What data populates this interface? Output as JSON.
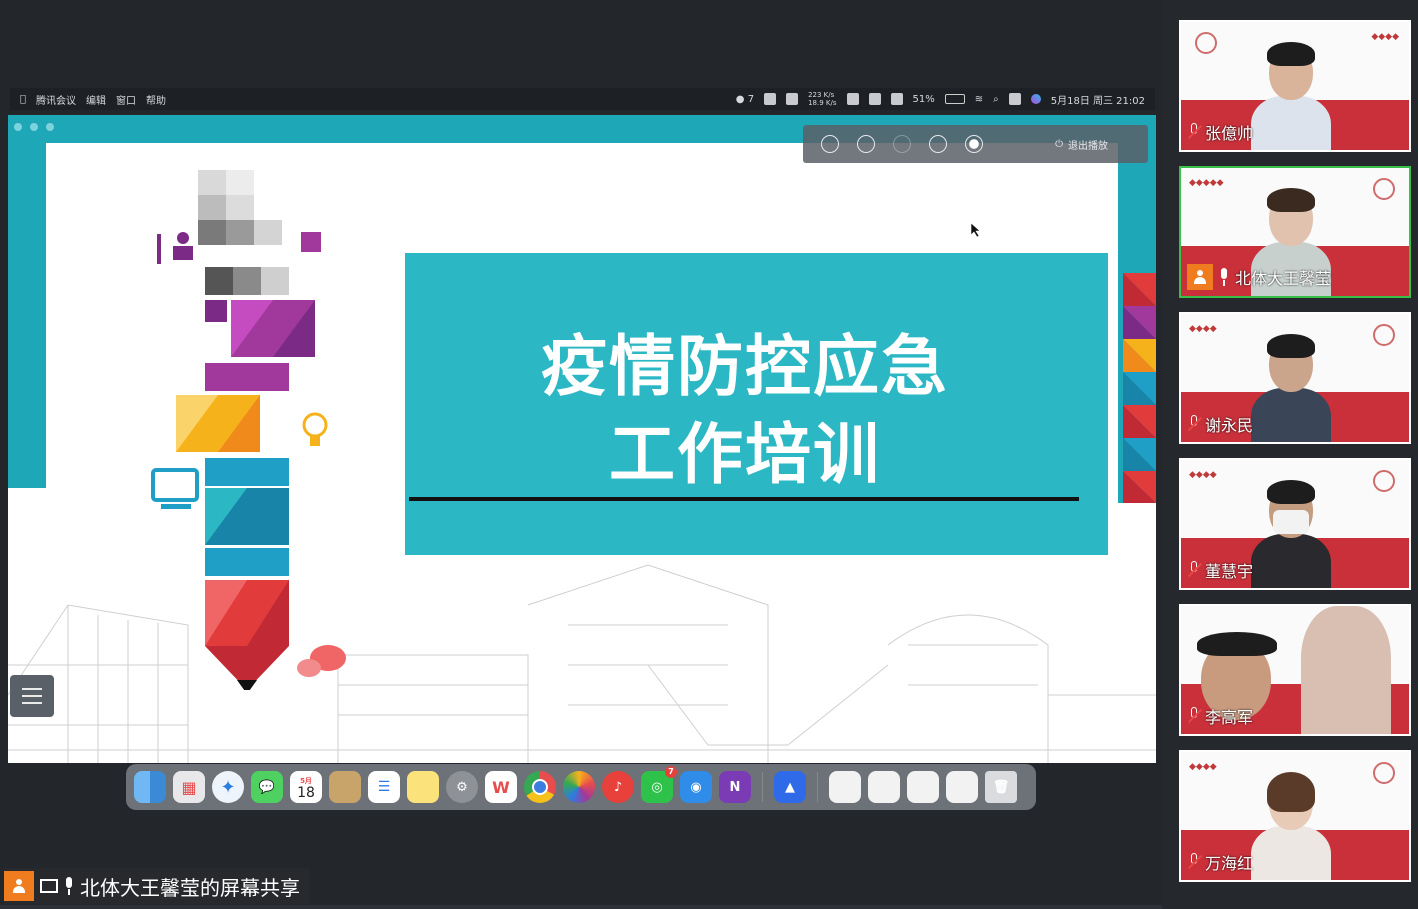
{
  "menubar": {
    "apple": "",
    "items": [
      "腾讯会议",
      "编辑",
      "窗口",
      "帮助"
    ],
    "wechat_count": "7",
    "net_speed_up": "223 K/s",
    "net_speed_down": "18.9 K/s",
    "battery": "51%",
    "datetime": "5月18日 周三 21:02"
  },
  "toolbar": {
    "exit_label": "退出播放"
  },
  "slide": {
    "title_line1": "疫情防控应急",
    "title_line2": "工作培训",
    "accent_color": "#2bb7c4"
  },
  "dock": {
    "calendar_month": "5月",
    "calendar_day": "18",
    "wechat_badge": "7",
    "apps": [
      "finder-icon",
      "launchpad-icon",
      "safari-icon",
      "messages-icon",
      "calendar-icon",
      "contacts-icon",
      "reminders-icon",
      "notes-icon",
      "system-preferences-icon",
      "wps-icon",
      "chrome-icon",
      "photos-icon",
      "netease-music-icon",
      "wechat-icon",
      "qq-icon",
      "onenote-icon",
      "tencent-meeting-icon",
      "trash-icon"
    ]
  },
  "share_label": "北体大王馨莹的屏幕共享",
  "participants": [
    {
      "name": "张億帅",
      "muted": true
    },
    {
      "name": "北体大王馨莹",
      "muted": false,
      "active": true
    },
    {
      "name": "谢永民",
      "muted": true
    },
    {
      "name": "董慧宇",
      "muted": true
    },
    {
      "name": "李高军",
      "muted": true
    },
    {
      "name": "万海红",
      "muted": true
    }
  ]
}
